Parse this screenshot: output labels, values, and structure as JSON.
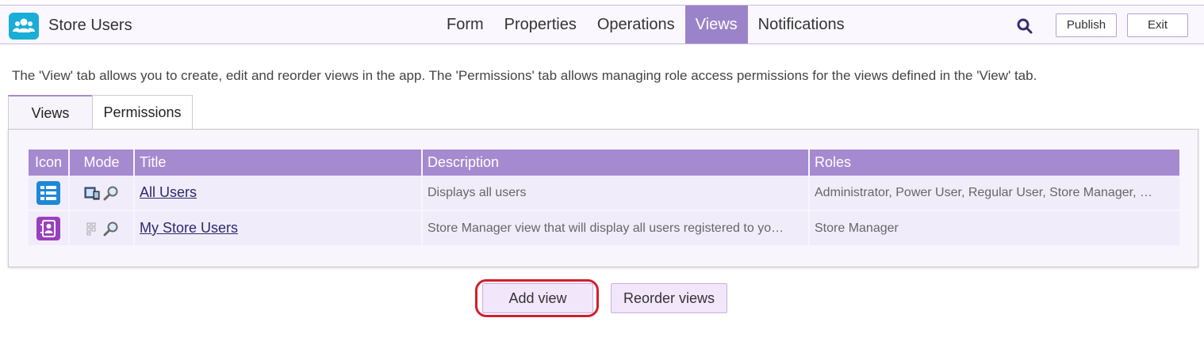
{
  "app": {
    "title": "Store Users"
  },
  "nav": [
    "Form",
    "Properties",
    "Operations",
    "Views",
    "Notifications"
  ],
  "nav_active": "Views",
  "buttons": {
    "publish": "Publish",
    "exit": "Exit",
    "add_view": "Add view",
    "reorder_views": "Reorder views"
  },
  "intro": "The 'View' tab allows you to create, edit and reorder views in the app. The 'Permissions' tab allows managing role access permissions for the views defined in the 'View' tab.",
  "tabs": {
    "views": "Views",
    "permissions": "Permissions"
  },
  "table": {
    "headers": {
      "icon": "Icon",
      "mode": "Mode",
      "title": "Title",
      "description": "Description",
      "roles": "Roles"
    },
    "rows": [
      {
        "icon": "table-list-icon",
        "icon_color": "#1e88d8",
        "title": "All Users",
        "description": "Displays all users",
        "roles": "Administrator, Power User, Regular User, Store Manager, …"
      },
      {
        "icon": "contact-card-icon",
        "icon_color": "#9b3fbf",
        "title": "My Store Users",
        "description": "Store Manager view that will display all users registered to yo…",
        "roles": "Store Manager"
      }
    ]
  },
  "colors": {
    "accent": "#a68ad0",
    "nav_active": "#9b83c9",
    "app_icon": "#1aaed6",
    "highlight": "#d41e2c"
  }
}
